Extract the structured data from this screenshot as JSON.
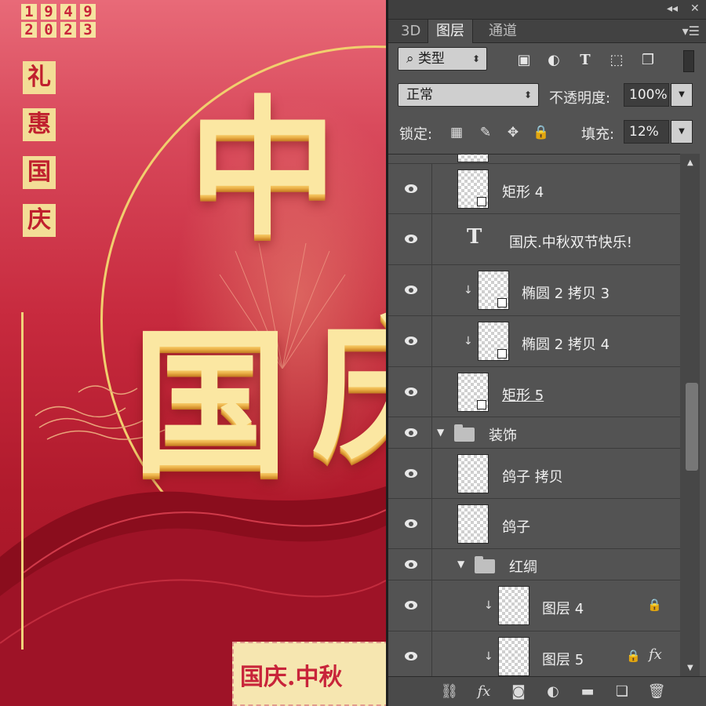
{
  "poster": {
    "year_top": "1949",
    "year_bottom": "2023",
    "vertical_chars": [
      "礼",
      "惠",
      "国",
      "庆"
    ],
    "big_char_1": "中",
    "big_char_2": "国",
    "big_char_3": "庆",
    "bottom_banner": "国庆.中秋"
  },
  "panel": {
    "tabs": [
      "3D",
      "图层",
      "通道"
    ],
    "active_tab": "图层",
    "filter_type": "类型",
    "blend_mode": "正常",
    "opacity_label": "不透明度:",
    "opacity_value": "100%",
    "lock_label": "锁定:",
    "fill_label": "填充:",
    "fill_value": "12%",
    "layers": [
      {
        "name": "矩形 4",
        "kind": "shape"
      },
      {
        "name": "国庆.中秋双节快乐!",
        "kind": "text"
      },
      {
        "name": "椭圆 2 拷贝 3",
        "kind": "clipped-shape"
      },
      {
        "name": "椭圆 2 拷贝 4",
        "kind": "clipped-shape"
      },
      {
        "name": "矩形 5",
        "kind": "shape"
      },
      {
        "name": "装饰",
        "kind": "group"
      },
      {
        "name": "鸽子 拷贝",
        "kind": "pixel"
      },
      {
        "name": "鸽子",
        "kind": "pixel"
      },
      {
        "name": "红绸",
        "kind": "group"
      },
      {
        "name": "图层 4",
        "kind": "clipped-pixel-locked"
      },
      {
        "name": "图层 5",
        "kind": "clipped-pixel-locked-fx"
      }
    ],
    "colors": {
      "panel_bg": "#535353",
      "canvas_red": "#c72a3e",
      "gold": "#fbe7a2"
    }
  }
}
